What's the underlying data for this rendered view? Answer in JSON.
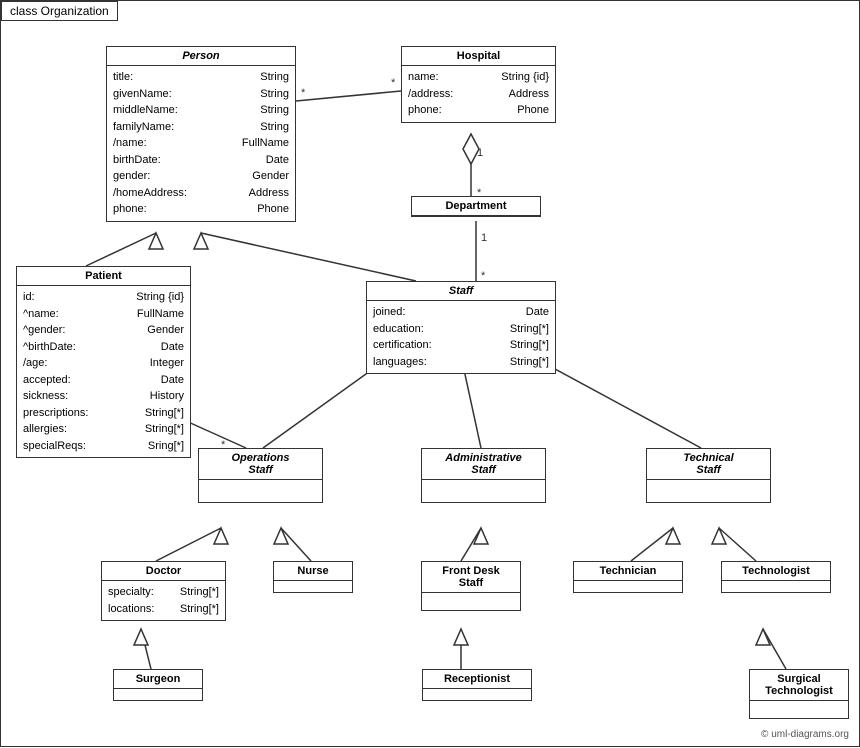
{
  "title": "class Organization",
  "classes": {
    "person": {
      "name": "Person",
      "italic": true,
      "attrs": [
        [
          "title:",
          "String"
        ],
        [
          "givenName:",
          "String"
        ],
        [
          "middleName:",
          "String"
        ],
        [
          "familyName:",
          "String"
        ],
        [
          "/name:",
          "FullName"
        ],
        [
          "birthDate:",
          "Date"
        ],
        [
          "gender:",
          "Gender"
        ],
        [
          "/homeAddress:",
          "Address"
        ],
        [
          "phone:",
          "Phone"
        ]
      ]
    },
    "hospital": {
      "name": "Hospital",
      "italic": false,
      "attrs": [
        [
          "name:",
          "String {id}"
        ],
        [
          "/address:",
          "Address"
        ],
        [
          "phone:",
          "Phone"
        ]
      ]
    },
    "department": {
      "name": "Department",
      "italic": false,
      "attrs": []
    },
    "staff": {
      "name": "Staff",
      "italic": true,
      "attrs": [
        [
          "joined:",
          "Date"
        ],
        [
          "education:",
          "String[*]"
        ],
        [
          "certification:",
          "String[*]"
        ],
        [
          "languages:",
          "String[*]"
        ]
      ]
    },
    "patient": {
      "name": "Patient",
      "italic": false,
      "attrs": [
        [
          "id:",
          "String {id}"
        ],
        [
          "^name:",
          "FullName"
        ],
        [
          "^gender:",
          "Gender"
        ],
        [
          "^birthDate:",
          "Date"
        ],
        [
          "/age:",
          "Integer"
        ],
        [
          "accepted:",
          "Date"
        ],
        [
          "sickness:",
          "History"
        ],
        [
          "prescriptions:",
          "String[*]"
        ],
        [
          "allergies:",
          "String[*]"
        ],
        [
          "specialReqs:",
          "Sring[*]"
        ]
      ]
    },
    "operations_staff": {
      "name": "Operations\nStaff",
      "italic": true,
      "attrs": []
    },
    "administrative_staff": {
      "name": "Administrative\nStaff",
      "italic": true,
      "attrs": []
    },
    "technical_staff": {
      "name": "Technical\nStaff",
      "italic": true,
      "attrs": []
    },
    "doctor": {
      "name": "Doctor",
      "italic": false,
      "attrs": [
        [
          "specialty:",
          "String[*]"
        ],
        [
          "locations:",
          "String[*]"
        ]
      ]
    },
    "nurse": {
      "name": "Nurse",
      "italic": false,
      "attrs": []
    },
    "front_desk_staff": {
      "name": "Front Desk\nStaff",
      "italic": false,
      "attrs": []
    },
    "technician": {
      "name": "Technician",
      "italic": false,
      "attrs": []
    },
    "technologist": {
      "name": "Technologist",
      "italic": false,
      "attrs": []
    },
    "surgeon": {
      "name": "Surgeon",
      "italic": false,
      "attrs": []
    },
    "receptionist": {
      "name": "Receptionist",
      "italic": false,
      "attrs": []
    },
    "surgical_technologist": {
      "name": "Surgical\nTechnologist",
      "italic": false,
      "attrs": []
    }
  },
  "labels": {
    "multiplicity_star": "*",
    "multiplicity_1": "1",
    "copyright": "© uml-diagrams.org"
  }
}
